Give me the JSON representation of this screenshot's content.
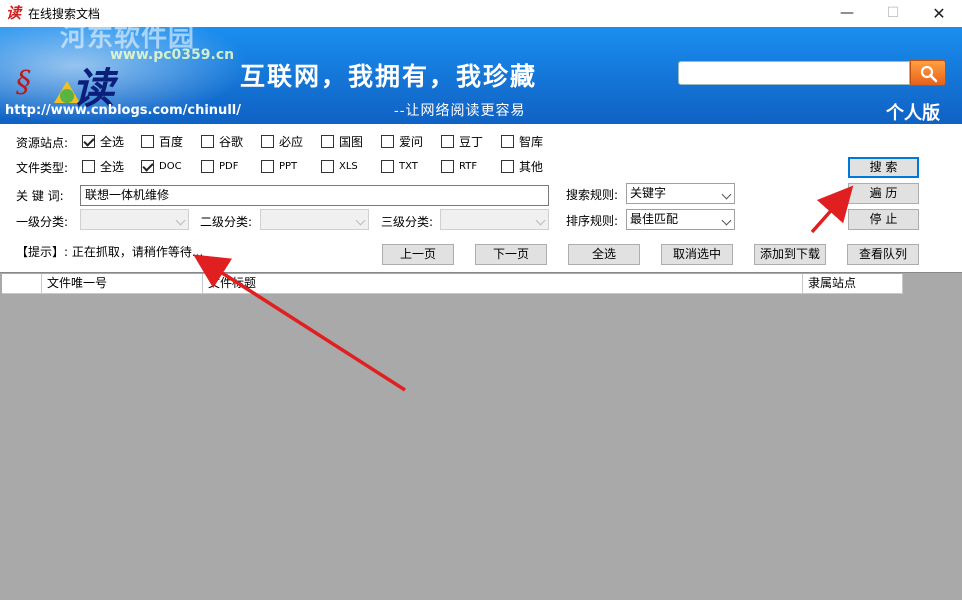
{
  "window": {
    "app_icon": "读",
    "title": "在线搜索文档",
    "min_glyph": "—",
    "max_glyph": "☐",
    "close_glyph": "✕"
  },
  "banner": {
    "slogan": "互联网，我拥有，我珍藏",
    "subslogan": "--让网络阅读更容易",
    "url": "http://www.cnblogs.com/chinull/",
    "edition": "个人版",
    "logo_text": "读",
    "watermark_name": "河东软件园",
    "watermark_site": "www.pc0359.cn",
    "search_value": "",
    "search_icon": "magnifier-icon"
  },
  "form": {
    "sources_label": "资源站点:",
    "sources": [
      {
        "label": "全选",
        "checked": true
      },
      {
        "label": "百度",
        "checked": false
      },
      {
        "label": "谷歌",
        "checked": false
      },
      {
        "label": "必应",
        "checked": false
      },
      {
        "label": "国图",
        "checked": false
      },
      {
        "label": "爱问",
        "checked": false
      },
      {
        "label": "豆丁",
        "checked": false
      },
      {
        "label": "智库",
        "checked": false
      }
    ],
    "types_label": "文件类型:",
    "types": [
      {
        "label": "全选",
        "checked": false
      },
      {
        "label": "DOC",
        "checked": true
      },
      {
        "label": "PDF",
        "checked": false
      },
      {
        "label": "PPT",
        "checked": false
      },
      {
        "label": "XLS",
        "checked": false
      },
      {
        "label": "TXT",
        "checked": false
      },
      {
        "label": "RTF",
        "checked": false
      },
      {
        "label": "其他",
        "checked": false
      }
    ],
    "keyword_label": "关 键 词:",
    "keyword_value": "联想一体机维修",
    "cat1_label": "一级分类:",
    "cat2_label": "二级分类:",
    "cat3_label": "三级分类:",
    "search_rule_label": "搜索规则:",
    "search_rule_value": "关键字",
    "sort_rule_label": "排序规则:",
    "sort_rule_value": "最佳匹配",
    "hint": "【提示】: 正在抓取，请稍作等待..."
  },
  "buttons": {
    "search": "搜  索",
    "traverse": "遍  历",
    "stop": "停  止",
    "prev": "上一页",
    "next": "下一页",
    "select_all": "全选",
    "deselect": "取消选中",
    "add_download": "添加到下载",
    "view_queue": "查看队列"
  },
  "table": {
    "columns": [
      "",
      "文件唯一号",
      "文件标题",
      "隶属站点"
    ]
  },
  "colors": {
    "banner": "#1475d6",
    "arrow": "#e02020",
    "grid_bg": "#a9a9a9"
  }
}
